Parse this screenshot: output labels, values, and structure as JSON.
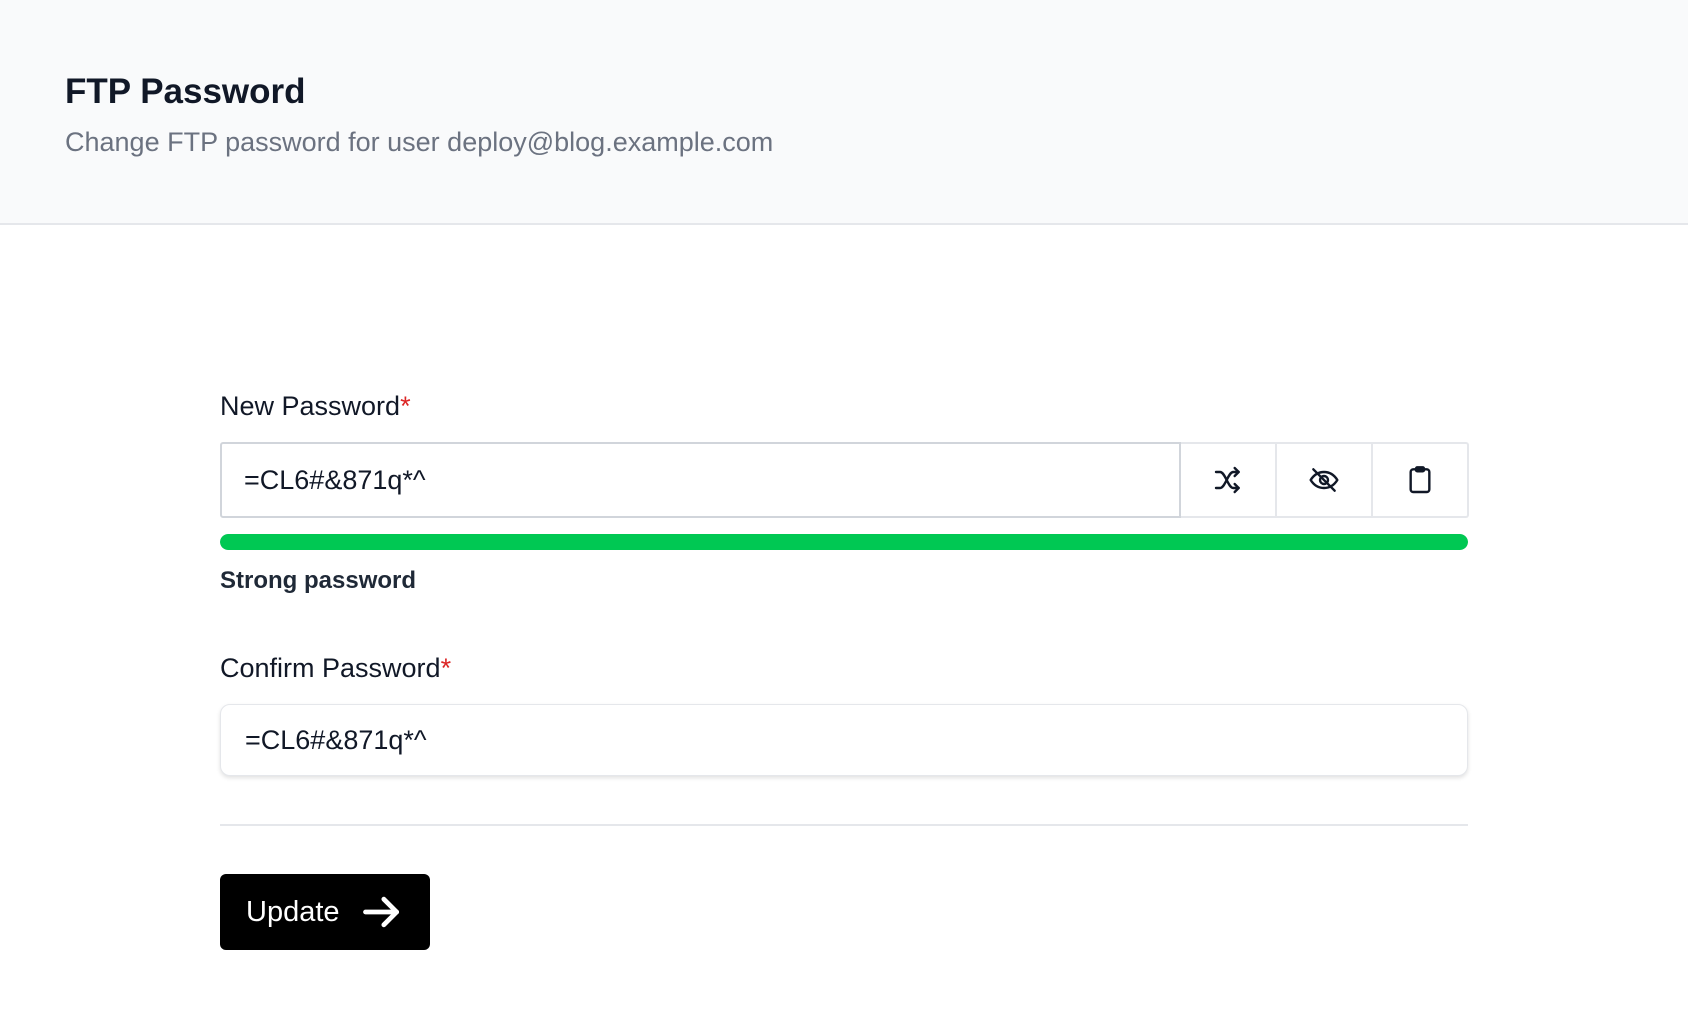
{
  "header": {
    "title": "FTP Password",
    "subtitle": "Change FTP password for user deploy@blog.example.com"
  },
  "new_password": {
    "label": "New Password",
    "required_mark": "*",
    "value": "=CL6#&871q*^",
    "buttons": [
      {
        "name": "generate-password-button",
        "icon": "shuffle-icon"
      },
      {
        "name": "toggle-visibility-button",
        "icon": "eye-off-icon"
      },
      {
        "name": "copy-password-button",
        "icon": "clipboard-icon"
      }
    ],
    "strength": {
      "level_percent": 100,
      "color": "#00c853",
      "text": "Strong password"
    }
  },
  "confirm_password": {
    "label": "Confirm Password",
    "required_mark": "*",
    "value": "=CL6#&871q*^"
  },
  "actions": {
    "update_label": "Update",
    "update_icon": "arrow-right-icon"
  }
}
